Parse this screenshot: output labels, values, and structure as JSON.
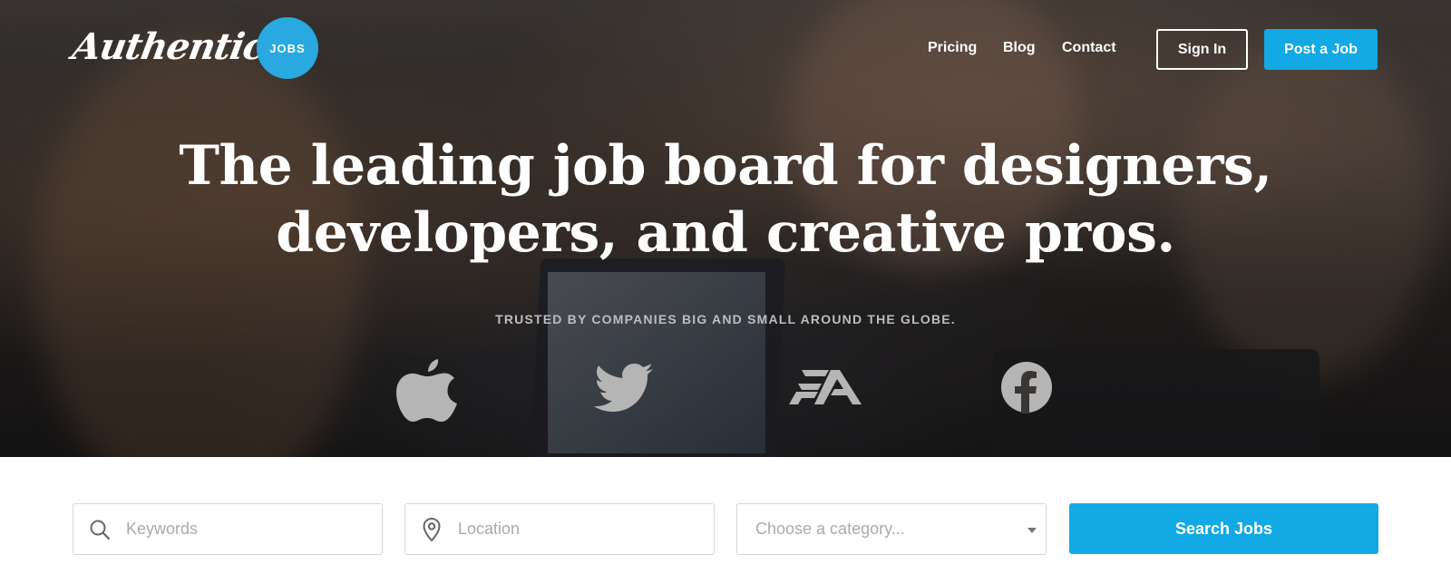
{
  "header": {
    "logo_text": "Authentic",
    "logo_badge": "JOBS",
    "nav": [
      {
        "label": "Pricing"
      },
      {
        "label": "Blog"
      },
      {
        "label": "Contact"
      }
    ],
    "sign_in_label": "Sign In",
    "post_job_label": "Post a Job"
  },
  "hero": {
    "headline_line1": "The leading job board for designers,",
    "headline_line2": "developers, and creative pros.",
    "trusted_text": "TRUSTED BY COMPANIES BIG AND SMALL AROUND THE GLOBE.",
    "brands": [
      {
        "icon": "apple-logo-icon"
      },
      {
        "icon": "twitter-logo-icon"
      },
      {
        "icon": "ea-logo-icon",
        "text": "EA"
      },
      {
        "icon": "facebook-logo-icon"
      }
    ]
  },
  "search": {
    "keywords_placeholder": "Keywords",
    "location_placeholder": "Location",
    "category_placeholder": "Choose a category...",
    "search_button_label": "Search Jobs"
  },
  "colors": {
    "accent": "#12a9e4",
    "badge": "#2aa8e0",
    "white": "#ffffff",
    "brand_logo_gray": "#b5b5b5"
  }
}
